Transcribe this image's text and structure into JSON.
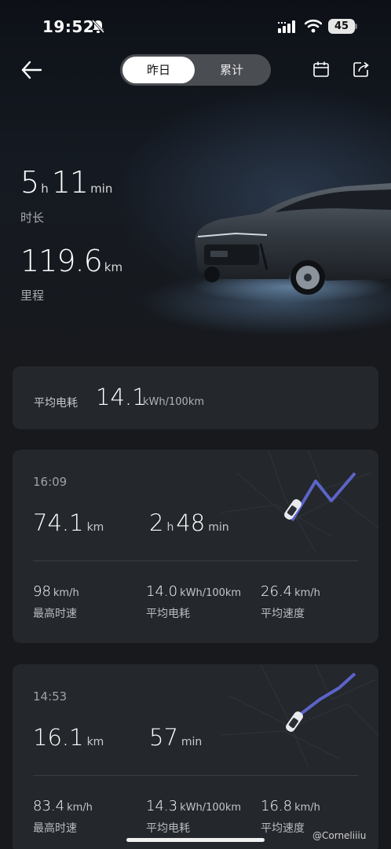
{
  "status_bar": {
    "time": "19:52",
    "battery": "45"
  },
  "header": {
    "tabs": [
      {
        "label": "昨日"
      },
      {
        "label": "累计"
      }
    ]
  },
  "summary": {
    "hours": "5",
    "hours_unit": "h",
    "minutes": "11",
    "minutes_unit": "min",
    "duration_label": "时长",
    "distance": "119.6",
    "distance_unit": "km",
    "distance_label": "里程"
  },
  "average": {
    "label": "平均电耗",
    "value": "14.1",
    "unit": "kWh/100km"
  },
  "trips": [
    {
      "time": "16:09",
      "distance": "74.1",
      "distance_unit": "km",
      "hours": "2",
      "hours_unit": "h",
      "minutes": "48",
      "minutes_unit": "min",
      "max_speed": "98",
      "max_speed_unit": "km/h",
      "max_speed_label": "最高时速",
      "consumption": "14.0",
      "consumption_unit": "kWh/100km",
      "consumption_label": "平均电耗",
      "avg_speed": "26.4",
      "avg_speed_unit": "km/h",
      "avg_speed_label": "平均速度"
    },
    {
      "time": "14:53",
      "distance": "16.1",
      "distance_unit": "km",
      "minutes": "57",
      "minutes_unit": "min",
      "max_speed": "83.4",
      "max_speed_unit": "km/h",
      "max_speed_label": "最高时速",
      "consumption": "14.3",
      "consumption_unit": "kWh/100km",
      "consumption_label": "平均电耗",
      "avg_speed": "16.8",
      "avg_speed_unit": "km/h",
      "avg_speed_label": "平均速度"
    }
  ],
  "watermark": "@Corneliiiu",
  "colors": {
    "background": "#17191d",
    "card": "#24272c",
    "route": "#5c64c8"
  }
}
